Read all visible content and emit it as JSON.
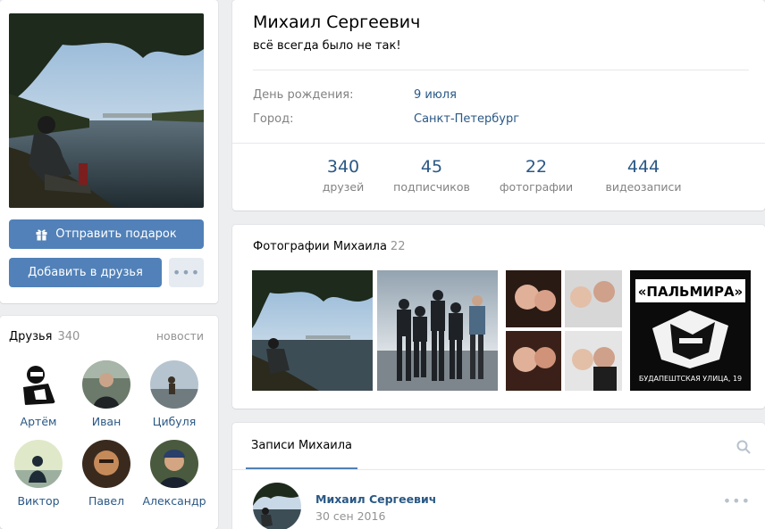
{
  "profile": {
    "name": "Михаил Сергеевич",
    "status": "всё всегда было не так!",
    "info": [
      {
        "label": "День рождения:",
        "value": "9 июля"
      },
      {
        "label": "Город:",
        "value": "Санкт-Петербург"
      }
    ],
    "counters": [
      {
        "num": "340",
        "label": "друзей"
      },
      {
        "num": "45",
        "label": "подписчиков"
      },
      {
        "num": "22",
        "label": "фотографии"
      },
      {
        "num": "444",
        "label": "видеозаписи"
      }
    ]
  },
  "actions": {
    "gift_label": "Отправить подарок",
    "add_friend_label": "Добавить в друзья",
    "more_label": "•••",
    "gift_icon": "gift-icon"
  },
  "friends": {
    "title": "Друзья",
    "count": "340",
    "news_link": "новости",
    "items": [
      {
        "name": "Артём"
      },
      {
        "name": "Иван"
      },
      {
        "name": "Цибуля"
      },
      {
        "name": "Виктор"
      },
      {
        "name": "Павел"
      },
      {
        "name": "Александр"
      }
    ]
  },
  "photos": {
    "title": "Фотографии Михаила",
    "count": "22",
    "poster_title": "«ПАЛЬМИРА»",
    "poster_address": "БУДАПЕШТСКАЯ УЛИЦА, 19"
  },
  "wall": {
    "tab_label": "Записи Михаила",
    "search_icon": "search-icon",
    "post": {
      "author": "Михаил Сергеевич",
      "date": "30 сен 2016",
      "more_label": "•••"
    }
  },
  "colors": {
    "accent": "#5181b8",
    "link": "#2a5885",
    "muted": "#828282",
    "page_bg": "#edeef0"
  }
}
